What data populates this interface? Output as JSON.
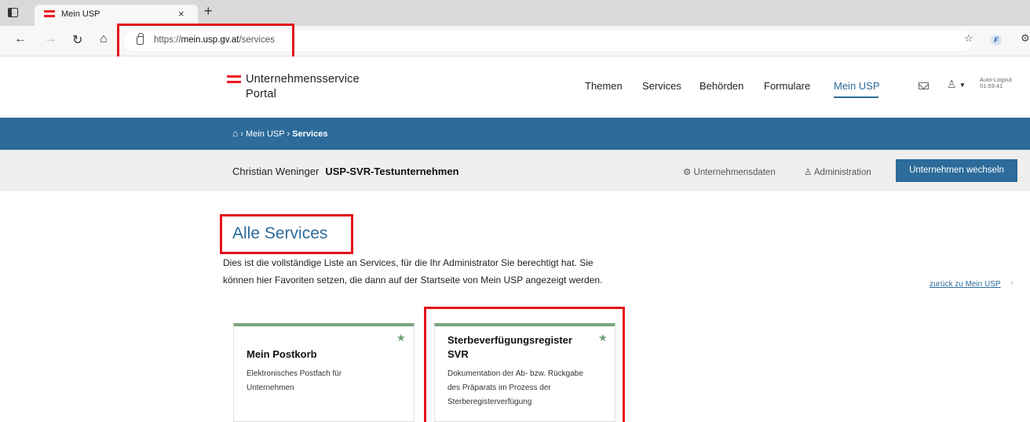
{
  "browser": {
    "tab_title": "Mein USP",
    "tab_close": "×",
    "new_tab": "+",
    "url_prefix": "https://",
    "url_domain": "mein.usp.gv.at",
    "url_path": "/services"
  },
  "header": {
    "logo_line1": "Unternehmensservice",
    "logo_line2": "Portal",
    "nav": [
      "Themen",
      "Services",
      "Behörden",
      "Formulare",
      "Mein USP"
    ],
    "active_nav": "Mein USP",
    "logout_label": "Auto-Logout",
    "logout_time": "01:59:41"
  },
  "breadcrumb": {
    "home_icon": "home-icon",
    "items": [
      "Mein USP",
      "Services"
    ]
  },
  "userbar": {
    "name": "Christian Weninger",
    "company": "USP-SVR-Testunternehmen",
    "company_data": "Unternehmensdaten",
    "administration": "Administration",
    "switch_button": "Unternehmen wechseln"
  },
  "content": {
    "title": "Alle Services",
    "intro_line1": "Dies ist die vollständige Liste an Services, für die Ihr Administrator Sie berechtigt hat. Sie",
    "intro_line2": "können hier Favoriten setzen, die dann auf der Startseite von Mein USP angezeigt werden.",
    "back_link": "zurück zu Mein USP"
  },
  "cards": [
    {
      "title": "Mein Postkorb",
      "desc_line1": "Elektronisches Postfach für",
      "desc_line2": "Unternehmen",
      "favorite": true
    },
    {
      "title_line1": "Sterbeverfügungsregister",
      "title_line2": "SVR",
      "desc_line1": "Dokumentation der Ab- bzw. Rückgabe",
      "desc_line2": "des Präparats im Prozess der",
      "desc_line3": "Sterberegisterverfügung",
      "favorite": true
    }
  ],
  "colors": {
    "brand_blue": "#2c6b9a",
    "highlight_red": "#e3111b",
    "card_green": "#7aa57e",
    "austria_red": "#ed1c24"
  }
}
